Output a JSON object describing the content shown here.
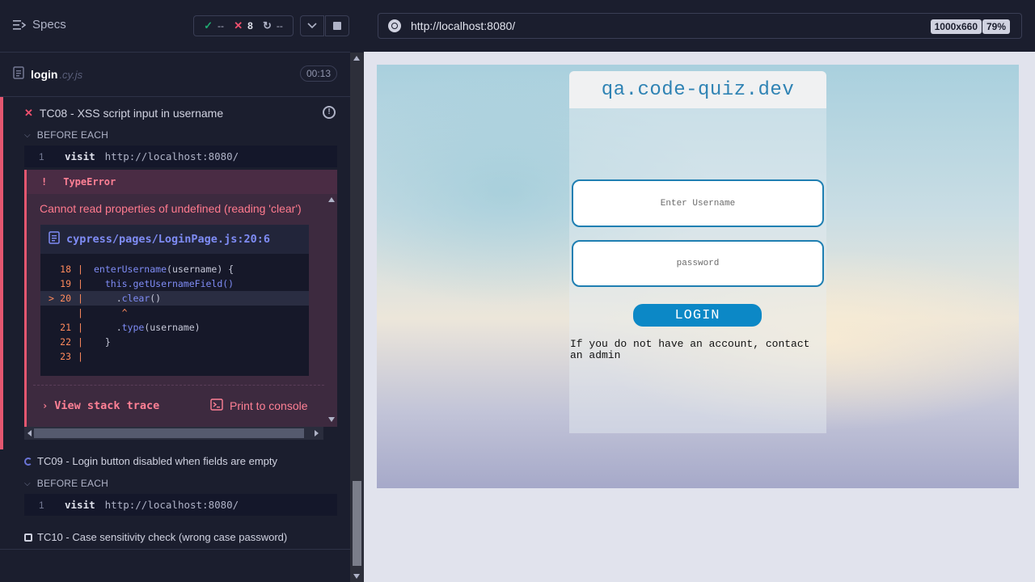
{
  "reporter": {
    "specs_label": "Specs",
    "stats": {
      "passed": "--",
      "failed": "8",
      "pending": "--"
    },
    "spec": {
      "name": "login",
      "ext": ".cy.js",
      "duration": "00:13"
    },
    "tests": [
      {
        "title": "TC08 - XSS script input in username",
        "state": "failed"
      },
      {
        "title": "TC09 - Login button disabled when fields are empty",
        "state": "running"
      },
      {
        "title": "TC10 - Case sensitivity check (wrong case password)",
        "state": "pending"
      }
    ],
    "before_each_label": "BEFORE EACH",
    "command": {
      "index": "1",
      "name": "visit",
      "arg": "http://localhost:8080/"
    },
    "error": {
      "marker": "!",
      "type": "TypeError",
      "message": "Cannot read properties of undefined (reading 'clear')",
      "file": "cypress/pages/LoginPage.js:20:6",
      "code": [
        {
          "ln": "18",
          "pre": "",
          "fn": "enterUsername",
          "post": "(username) {"
        },
        {
          "ln": "19",
          "pre": "  ",
          "fn": "this",
          "post": ".getUsernameField()"
        },
        {
          "ln": "20",
          "pre": "    .",
          "fn": "clear",
          "post": "()"
        },
        {
          "ln": "",
          "pre": "     ^",
          "fn": "",
          "post": ""
        },
        {
          "ln": "21",
          "pre": "    .",
          "fn": "type",
          "post": "(username)"
        },
        {
          "ln": "22",
          "pre": "  }",
          "fn": "",
          "post": ""
        },
        {
          "ln": "23",
          "pre": "",
          "fn": "",
          "post": ""
        }
      ],
      "current_marker": ">",
      "view_stack_trace": "View stack trace",
      "print_to_console": "Print to console"
    }
  },
  "aut": {
    "url": "http://localhost:8080/",
    "viewport": "1000x660",
    "zoom": "79%",
    "page": {
      "brand": "qa.code-quiz.dev",
      "username_placeholder": "Enter Username",
      "password_placeholder": "password",
      "login_button": "LOGIN",
      "help_text": "If you do not have an account, contact an admin"
    }
  },
  "colors": {
    "failed": "#f0506e",
    "passed": "#1fa971",
    "running": "#6b75d8",
    "brand": "#2f83b4",
    "login_button": "#0c88c6"
  }
}
